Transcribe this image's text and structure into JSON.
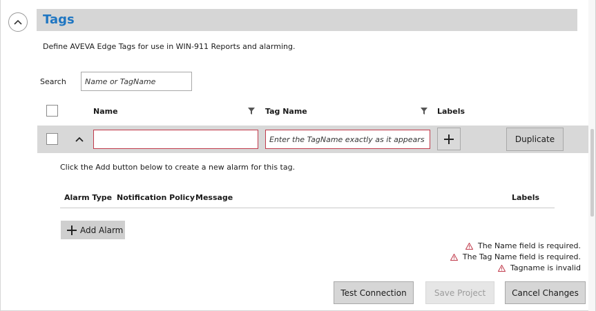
{
  "section": {
    "title": "Tags",
    "description": "Define AVEVA Edge Tags for use in WIN-911 Reports and alarming.",
    "collapse_icon": "chevron-up-icon"
  },
  "search": {
    "label": "Search",
    "placeholder": "Name or TagName"
  },
  "table": {
    "columns": {
      "name": "Name",
      "tag_name": "Tag Name",
      "labels": "Labels"
    }
  },
  "row": {
    "name_value": "",
    "tag_placeholder": "Enter the TagName exactly as it appears in AVEVA Edge",
    "duplicate_label": "Duplicate",
    "add_label_icon": "plus-icon"
  },
  "alarms": {
    "info": "Click the Add button below to create a new alarm for this tag.",
    "columns": {
      "alarm_type": "Alarm Type",
      "notification_policy": "Notification Policy",
      "message": "Message",
      "labels": "Labels"
    },
    "add_label": "Add Alarm"
  },
  "errors": [
    "The Name field is required.",
    "The Tag Name field is required.",
    "Tagname is invalid"
  ],
  "footer": {
    "test_connection": "Test Connection",
    "save_project": "Save Project",
    "cancel_changes": "Cancel Changes"
  },
  "colors": {
    "accent": "#1f76c2",
    "error": "#c0394a",
    "header_bg": "#d6d6d6"
  }
}
